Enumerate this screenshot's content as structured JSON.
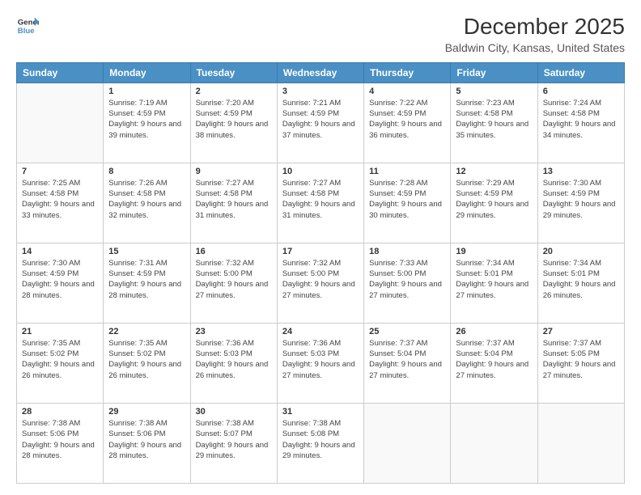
{
  "header": {
    "logo_line1": "General",
    "logo_line2": "Blue",
    "title": "December 2025",
    "subtitle": "Baldwin City, Kansas, United States"
  },
  "calendar": {
    "days_of_week": [
      "Sunday",
      "Monday",
      "Tuesday",
      "Wednesday",
      "Thursday",
      "Friday",
      "Saturday"
    ],
    "weeks": [
      [
        {
          "day": "",
          "info": ""
        },
        {
          "day": "1",
          "info": "Sunrise: 7:19 AM\nSunset: 4:59 PM\nDaylight: 9 hours\nand 39 minutes."
        },
        {
          "day": "2",
          "info": "Sunrise: 7:20 AM\nSunset: 4:59 PM\nDaylight: 9 hours\nand 38 minutes."
        },
        {
          "day": "3",
          "info": "Sunrise: 7:21 AM\nSunset: 4:59 PM\nDaylight: 9 hours\nand 37 minutes."
        },
        {
          "day": "4",
          "info": "Sunrise: 7:22 AM\nSunset: 4:59 PM\nDaylight: 9 hours\nand 36 minutes."
        },
        {
          "day": "5",
          "info": "Sunrise: 7:23 AM\nSunset: 4:58 PM\nDaylight: 9 hours\nand 35 minutes."
        },
        {
          "day": "6",
          "info": "Sunrise: 7:24 AM\nSunset: 4:58 PM\nDaylight: 9 hours\nand 34 minutes."
        }
      ],
      [
        {
          "day": "7",
          "info": "Sunrise: 7:25 AM\nSunset: 4:58 PM\nDaylight: 9 hours\nand 33 minutes."
        },
        {
          "day": "8",
          "info": "Sunrise: 7:26 AM\nSunset: 4:58 PM\nDaylight: 9 hours\nand 32 minutes."
        },
        {
          "day": "9",
          "info": "Sunrise: 7:27 AM\nSunset: 4:58 PM\nDaylight: 9 hours\nand 31 minutes."
        },
        {
          "day": "10",
          "info": "Sunrise: 7:27 AM\nSunset: 4:58 PM\nDaylight: 9 hours\nand 31 minutes."
        },
        {
          "day": "11",
          "info": "Sunrise: 7:28 AM\nSunset: 4:59 PM\nDaylight: 9 hours\nand 30 minutes."
        },
        {
          "day": "12",
          "info": "Sunrise: 7:29 AM\nSunset: 4:59 PM\nDaylight: 9 hours\nand 29 minutes."
        },
        {
          "day": "13",
          "info": "Sunrise: 7:30 AM\nSunset: 4:59 PM\nDaylight: 9 hours\nand 29 minutes."
        }
      ],
      [
        {
          "day": "14",
          "info": "Sunrise: 7:30 AM\nSunset: 4:59 PM\nDaylight: 9 hours\nand 28 minutes."
        },
        {
          "day": "15",
          "info": "Sunrise: 7:31 AM\nSunset: 4:59 PM\nDaylight: 9 hours\nand 28 minutes."
        },
        {
          "day": "16",
          "info": "Sunrise: 7:32 AM\nSunset: 5:00 PM\nDaylight: 9 hours\nand 27 minutes."
        },
        {
          "day": "17",
          "info": "Sunrise: 7:32 AM\nSunset: 5:00 PM\nDaylight: 9 hours\nand 27 minutes."
        },
        {
          "day": "18",
          "info": "Sunrise: 7:33 AM\nSunset: 5:00 PM\nDaylight: 9 hours\nand 27 minutes."
        },
        {
          "day": "19",
          "info": "Sunrise: 7:34 AM\nSunset: 5:01 PM\nDaylight: 9 hours\nand 27 minutes."
        },
        {
          "day": "20",
          "info": "Sunrise: 7:34 AM\nSunset: 5:01 PM\nDaylight: 9 hours\nand 26 minutes."
        }
      ],
      [
        {
          "day": "21",
          "info": "Sunrise: 7:35 AM\nSunset: 5:02 PM\nDaylight: 9 hours\nand 26 minutes."
        },
        {
          "day": "22",
          "info": "Sunrise: 7:35 AM\nSunset: 5:02 PM\nDaylight: 9 hours\nand 26 minutes."
        },
        {
          "day": "23",
          "info": "Sunrise: 7:36 AM\nSunset: 5:03 PM\nDaylight: 9 hours\nand 26 minutes."
        },
        {
          "day": "24",
          "info": "Sunrise: 7:36 AM\nSunset: 5:03 PM\nDaylight: 9 hours\nand 27 minutes."
        },
        {
          "day": "25",
          "info": "Sunrise: 7:37 AM\nSunset: 5:04 PM\nDaylight: 9 hours\nand 27 minutes."
        },
        {
          "day": "26",
          "info": "Sunrise: 7:37 AM\nSunset: 5:04 PM\nDaylight: 9 hours\nand 27 minutes."
        },
        {
          "day": "27",
          "info": "Sunrise: 7:37 AM\nSunset: 5:05 PM\nDaylight: 9 hours\nand 27 minutes."
        }
      ],
      [
        {
          "day": "28",
          "info": "Sunrise: 7:38 AM\nSunset: 5:06 PM\nDaylight: 9 hours\nand 28 minutes."
        },
        {
          "day": "29",
          "info": "Sunrise: 7:38 AM\nSunset: 5:06 PM\nDaylight: 9 hours\nand 28 minutes."
        },
        {
          "day": "30",
          "info": "Sunrise: 7:38 AM\nSunset: 5:07 PM\nDaylight: 9 hours\nand 29 minutes."
        },
        {
          "day": "31",
          "info": "Sunrise: 7:38 AM\nSunset: 5:08 PM\nDaylight: 9 hours\nand 29 minutes."
        },
        {
          "day": "",
          "info": ""
        },
        {
          "day": "",
          "info": ""
        },
        {
          "day": "",
          "info": ""
        }
      ]
    ]
  }
}
